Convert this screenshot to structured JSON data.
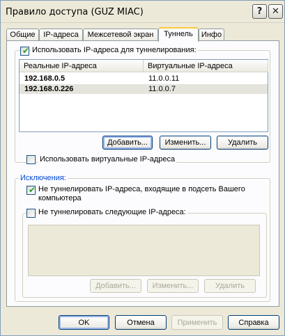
{
  "window": {
    "title": "Правило доступа (GUZ MIAC)",
    "help_glyph": "?",
    "close_glyph": "✕"
  },
  "tabs": [
    {
      "label": "Общие"
    },
    {
      "label": "IP-адреса"
    },
    {
      "label": "Межсетевой экран"
    },
    {
      "label": "Туннель",
      "active": true
    },
    {
      "label": "Инфо"
    }
  ],
  "tunnel": {
    "use_tunnel_label": "Использовать IP-адреса для туннелирования:",
    "use_tunnel_checked": true,
    "columns": [
      "Реальные IP-адреса",
      "Виртуальные IP-адреса"
    ],
    "rows": [
      {
        "real": "192.168.0.5",
        "virtual": "11.0.0.11"
      },
      {
        "real": "192.168.0.226",
        "virtual": "11.0.0.7"
      }
    ],
    "selected_row": 1,
    "add_label": "Добавить...",
    "edit_label": "Изменить...",
    "delete_label": "Удалить"
  },
  "virtual": {
    "label": "Использовать виртуальные IP-адреса",
    "checked": false
  },
  "exclusions": {
    "legend": "Исключения:",
    "subnet_label_1": "Не туннелировать IP-адреса, входящие в подсеть Вашего",
    "subnet_label_2": "компьютера",
    "subnet_checked": true,
    "following_label": "Не туннелировать следующие IP-адреса:",
    "following_checked": false,
    "add_label": "Добавить...",
    "edit_label": "Изменить...",
    "delete_label": "Удалить"
  },
  "footer": {
    "ok_label": "OK",
    "cancel_label": "Отмена",
    "apply_label": "Применить",
    "help_label": "Справка"
  },
  "colors": {
    "accent_tab": "#ffc83c",
    "legend_blue": "#0046d5",
    "check_green": "#21a121"
  }
}
